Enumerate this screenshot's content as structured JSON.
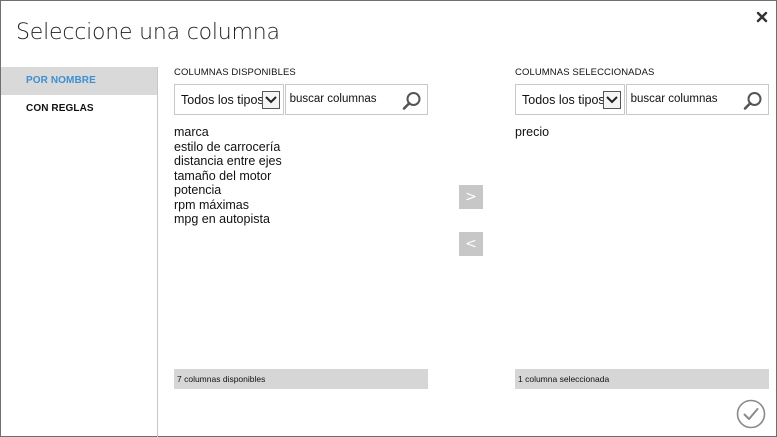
{
  "dialog": {
    "title": "Seleccione una columna"
  },
  "sidebar": {
    "items": [
      {
        "label": "POR NOMBRE",
        "active": true
      },
      {
        "label": "CON REGLAS",
        "active": false
      }
    ]
  },
  "available": {
    "label": "COLUMNAS DISPONIBLES",
    "type_filter": "Todos los tipos",
    "search_placeholder": "buscar columnas",
    "columns": [
      "marca",
      "estilo de carrocería",
      "distancia entre ejes",
      "tamaño del motor",
      "potencia",
      "rpm máximas",
      "mpg en autopista"
    ],
    "footer": "7 columnas disponibles"
  },
  "selected": {
    "label": "COLUMNAS SELECCIONADAS",
    "type_filter": "Todos los tipos",
    "search_placeholder": "buscar columnas",
    "columns": [
      "precio"
    ],
    "footer": "1 columna seleccionada"
  },
  "buttons": {
    "add": ">",
    "remove": "<"
  },
  "icons": {
    "close": "close-icon",
    "search": "search-icon",
    "dropdown": "chevron-down-icon",
    "ok": "checkmark-circle-icon"
  },
  "colors": {
    "accent": "#3d8fd4",
    "active_bg": "#d9d9d9",
    "move_button": "#c7c7c7",
    "footer_bg": "#d6d6d6"
  }
}
